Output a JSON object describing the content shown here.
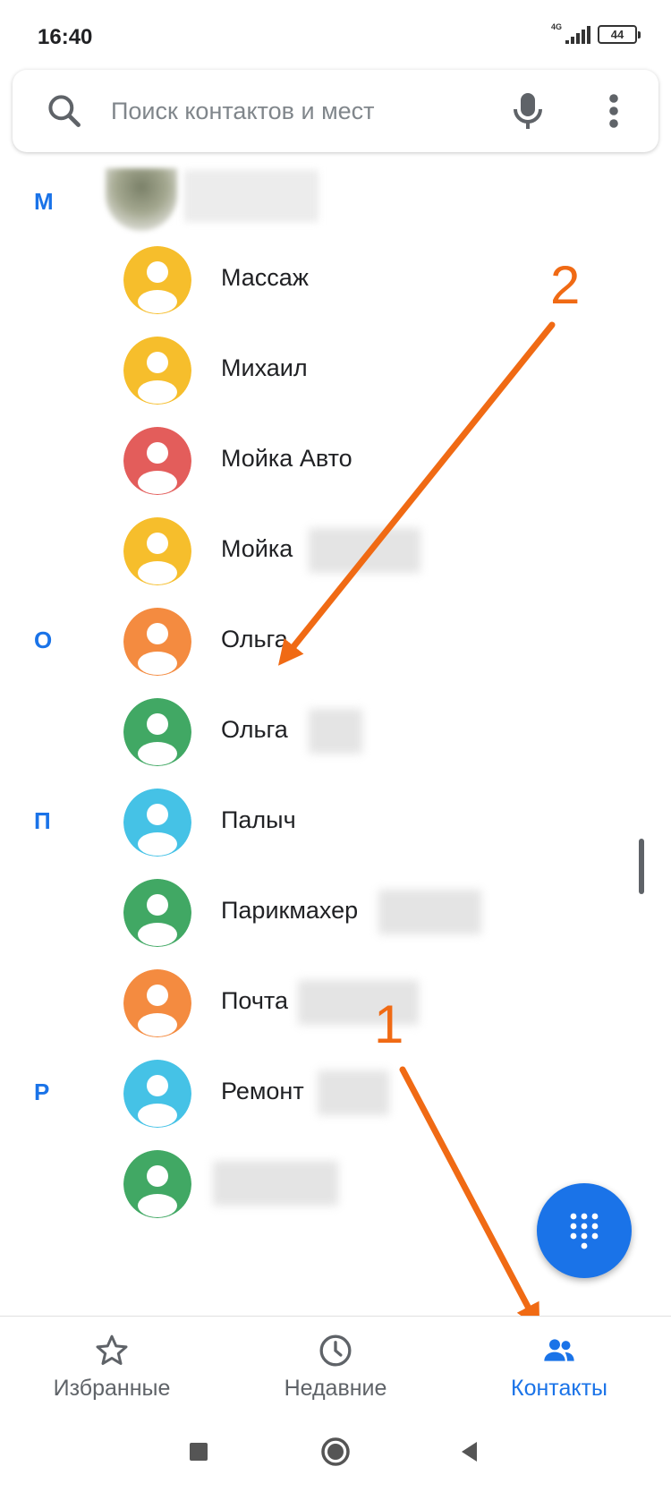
{
  "status_bar": {
    "time": "16:40",
    "network": "4G",
    "battery": "44"
  },
  "search": {
    "placeholder": "Поиск контактов и мест",
    "value": ""
  },
  "icons": {
    "search": "search-icon",
    "mic": "mic-icon",
    "more": "more-vert-icon",
    "dialpad": "dialpad-icon",
    "star": "star-icon",
    "clock": "clock-icon",
    "people": "people-icon"
  },
  "colors": {
    "accent": "#1a73e8",
    "yellow": "#f6be2c",
    "red": "#e35d5b",
    "orange": "#f48b40",
    "green": "#41a864",
    "cyan": "#45c2e6",
    "annotation": "#f06a14"
  },
  "sections": [
    {
      "letter": "М"
    },
    {
      "letter": "О"
    },
    {
      "letter": "П"
    },
    {
      "letter": "Р"
    }
  ],
  "contacts": [
    {
      "name": "Массаж",
      "color": "yellow"
    },
    {
      "name": "Михаил",
      "color": "yellow"
    },
    {
      "name": "Мойка Авто",
      "color": "red"
    },
    {
      "name": "Мойка",
      "color": "yellow"
    },
    {
      "name": "Ольга",
      "color": "orange"
    },
    {
      "name": "Ольга",
      "color": "green"
    },
    {
      "name": "Палыч",
      "color": "cyan"
    },
    {
      "name": "Парикмахер",
      "color": "green"
    },
    {
      "name": "Почта",
      "color": "orange"
    },
    {
      "name": "Ремонт",
      "color": "cyan"
    },
    {
      "name": "",
      "color": "green"
    }
  ],
  "annotations": {
    "label_1": "1",
    "label_2": "2"
  },
  "bottom_nav": {
    "tabs": [
      {
        "label": "Избранные",
        "icon": "star-icon",
        "active": false
      },
      {
        "label": "Недавние",
        "icon": "clock-icon",
        "active": false
      },
      {
        "label": "Контакты",
        "icon": "people-icon",
        "active": true
      }
    ]
  }
}
